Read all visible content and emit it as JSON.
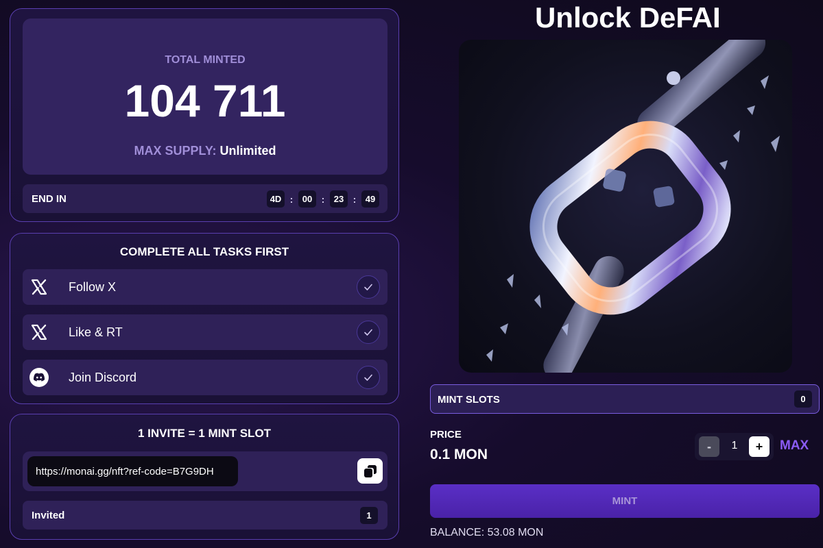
{
  "stats": {
    "total_label": "TOTAL MINTED",
    "total_value": "104 711",
    "max_supply_label": "MAX SUPPLY:",
    "max_supply_value": "Unlimited",
    "end_label": "END IN",
    "timer": {
      "days": "4D",
      "hours": "00",
      "minutes": "23",
      "seconds": "49",
      "separator": ":"
    }
  },
  "tasks": {
    "title": "COMPLETE ALL TASKS FIRST",
    "items": [
      {
        "label": "Follow X",
        "icon": "x-logo-icon",
        "completed": true
      },
      {
        "label": "Like & RT",
        "icon": "x-logo-icon",
        "completed": true
      },
      {
        "label": "Join Discord",
        "icon": "discord-icon",
        "completed": true
      }
    ]
  },
  "invite": {
    "title": "1 INVITE = 1 MINT SLOT",
    "link": "https://monai.gg/nft?ref-code=B7G9DH",
    "invited_label": "Invited",
    "invited_count": "1"
  },
  "mint": {
    "page_title": "Unlock DeFAI",
    "nft_image": "broken-chain-artwork",
    "slots_label": "MINT SLOTS",
    "slots_count": "0",
    "price_label": "PRICE",
    "price_value": "0.1 MON",
    "minus_label": "-",
    "quantity": "1",
    "plus_label": "+",
    "max_label": "MAX",
    "mint_label": "MINT",
    "balance": "BALANCE: 53.08 MON"
  },
  "colors": {
    "accent": "#8b5cf6",
    "card_border": "#5a3fb0",
    "mint_button": "#4a22a8"
  }
}
